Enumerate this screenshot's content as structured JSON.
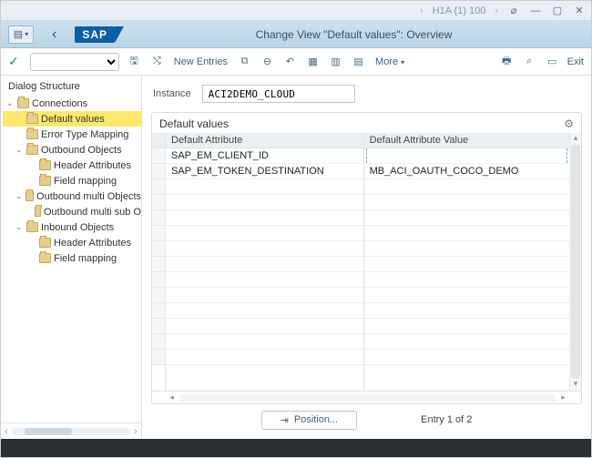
{
  "titlebar": {
    "system": "H1A (1) 100"
  },
  "header": {
    "page_title": "Change View \"Default values\": Overview",
    "logo": "SAP"
  },
  "toolbar": {
    "new_entries": "New Entries",
    "more": "More",
    "exit": "Exit"
  },
  "instance": {
    "label": "Instance",
    "value": "ACI2DEMO_CLOUD"
  },
  "group": {
    "title": "Default values",
    "col_attr": "Default Attribute",
    "col_val": "Default Attribute Value",
    "rows": [
      {
        "attr": "SAP_EM_CLIENT_ID",
        "val": ""
      },
      {
        "attr": "SAP_EM_TOKEN_DESTINATION",
        "val": "MB_ACI_OAUTH_COCO_DEMO"
      }
    ]
  },
  "sidebar": {
    "title": "Dialog Structure",
    "items": [
      {
        "label": "Connections",
        "level": 0,
        "expandable": true
      },
      {
        "label": "Default values",
        "level": 1,
        "selected": true
      },
      {
        "label": "Error Type Mapping",
        "level": 1
      },
      {
        "label": "Outbound  Objects",
        "level": 1,
        "expandable": true
      },
      {
        "label": "Header Attributes",
        "level": 2
      },
      {
        "label": "Field mapping",
        "level": 2
      },
      {
        "label": "Outbound multi Objects",
        "level": 1,
        "expandable": true
      },
      {
        "label": "Outbound multi sub O",
        "level": 2
      },
      {
        "label": "Inbound Objects",
        "level": 1,
        "expandable": true
      },
      {
        "label": "Header Attributes",
        "level": 2
      },
      {
        "label": "Field mapping",
        "level": 2
      }
    ]
  },
  "footer": {
    "position_btn": "Position...",
    "entry_text": "Entry 1 of 2"
  }
}
